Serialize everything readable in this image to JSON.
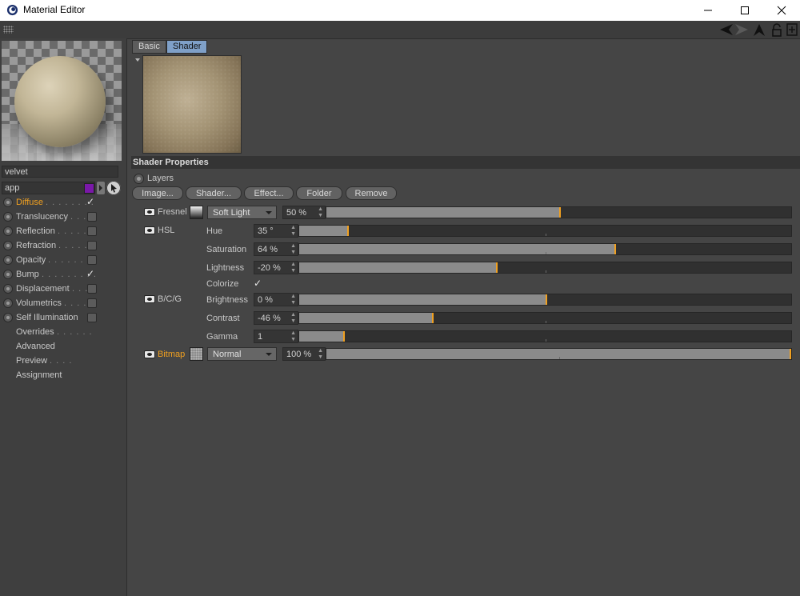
{
  "window": {
    "title": "Material Editor"
  },
  "material": {
    "name": "velvet",
    "channel_field": "app"
  },
  "channels": [
    {
      "label": "Diffuse",
      "dots": ". . . . . . . .",
      "active": true,
      "has_radio": true,
      "checked": true,
      "has_box": false
    },
    {
      "label": "Translucency",
      "dots": ". . .",
      "active": false,
      "has_radio": true,
      "checked": false,
      "has_box": true
    },
    {
      "label": "Reflection",
      "dots": ". . . . .",
      "active": false,
      "has_radio": true,
      "checked": false,
      "has_box": true
    },
    {
      "label": "Refraction",
      "dots": ". . . . .",
      "active": false,
      "has_radio": true,
      "checked": false,
      "has_box": true
    },
    {
      "label": "Opacity",
      "dots": ". . . . . . . .",
      "active": false,
      "has_radio": true,
      "checked": false,
      "has_box": true
    },
    {
      "label": "Bump",
      "dots": ". . . . . . . . .",
      "active": false,
      "has_radio": true,
      "checked": true,
      "has_box": false
    },
    {
      "label": "Displacement",
      "dots": ". . .",
      "active": false,
      "has_radio": true,
      "checked": false,
      "has_box": true
    },
    {
      "label": "Volumetrics",
      "dots": ". . . .",
      "active": false,
      "has_radio": true,
      "checked": false,
      "has_box": true
    },
    {
      "label": "Self Illumination",
      "dots": "",
      "active": false,
      "has_radio": true,
      "checked": false,
      "has_box": true
    },
    {
      "label": "Overrides",
      "dots": ". . . . . .",
      "active": false,
      "has_radio": false,
      "checked": false,
      "has_box": false
    },
    {
      "label": "Advanced",
      "dots": "",
      "active": false,
      "has_radio": false,
      "checked": false,
      "has_box": false
    },
    {
      "label": "Preview",
      "dots": ". . . .",
      "active": false,
      "has_radio": false,
      "checked": false,
      "has_box": false
    },
    {
      "label": "Assignment",
      "dots": "",
      "active": false,
      "has_radio": false,
      "checked": false,
      "has_box": false
    }
  ],
  "tabs": [
    {
      "label": "Basic",
      "selected": false
    },
    {
      "label": "Shader",
      "selected": true
    }
  ],
  "shader_properties": {
    "header": "Shader Properties",
    "mode_label": "Layers",
    "buttons": {
      "image": "Image...",
      "shader": "Shader...",
      "effect": "Effect...",
      "folder": "Folder",
      "remove": "Remove"
    },
    "fresnel": {
      "name": "Fresnel",
      "blend_mode": "Soft Light",
      "opacity": "50 %",
      "opacity_fraction": 0.5
    },
    "hsl": {
      "name": "HSL",
      "hue": {
        "label": "Hue",
        "value": "35 °",
        "fraction": 0.097
      },
      "saturation": {
        "label": "Saturation",
        "value": "64 %",
        "fraction": 0.64
      },
      "lightness": {
        "label": "Lightness",
        "value": "-20 %",
        "fraction": 0.4
      },
      "colorize": {
        "label": "Colorize",
        "checked": true,
        "mark": "✓"
      }
    },
    "bcg": {
      "name": "B/C/G",
      "brightness": {
        "label": "Brightness",
        "value": "0 %",
        "fraction": 0.5
      },
      "contrast": {
        "label": "Contrast",
        "value": "-46 %",
        "fraction": 0.27
      },
      "gamma": {
        "label": "Gamma",
        "value": "1",
        "fraction": 0.09
      }
    },
    "bitmap": {
      "name": "Bitmap",
      "blend_mode": "Normal",
      "opacity": "100 %",
      "opacity_fraction": 1.0
    }
  },
  "colors": {
    "accent": "#f0a020",
    "tab_selected": "#7fa0c8",
    "background": "#454545"
  }
}
